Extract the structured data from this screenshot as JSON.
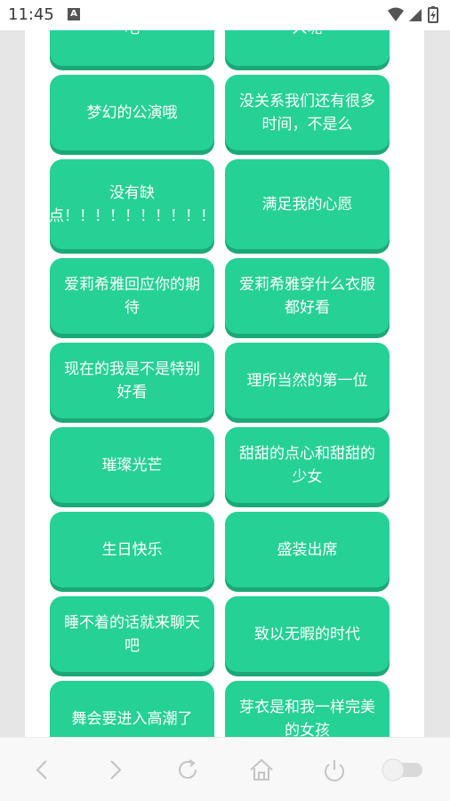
{
  "status": {
    "time": "11:45",
    "notification_badge": "A"
  },
  "cards": [
    {
      "label": "吧"
    },
    {
      "label": "人呢"
    },
    {
      "label": "梦幻的公演哦"
    },
    {
      "label": "没关系我们还有很多时间，不是么"
    },
    {
      "label": "没有缺点！！！！！！！！！！"
    },
    {
      "label": "满足我的心愿"
    },
    {
      "label": "爱莉希雅回应你的期待"
    },
    {
      "label": "爱莉希雅穿什么衣服都好看"
    },
    {
      "label": "现在的我是不是特别好看"
    },
    {
      "label": "理所当然的第一位"
    },
    {
      "label": "璀璨光芒"
    },
    {
      "label": "甜甜的点心和甜甜的少女"
    },
    {
      "label": "生日快乐"
    },
    {
      "label": "盛装出席"
    },
    {
      "label": "睡不着的话就来聊天吧"
    },
    {
      "label": "致以无暇的时代"
    },
    {
      "label": "舞会要进入高潮了"
    },
    {
      "label": "芽衣是和我一样完美的女孩"
    }
  ],
  "colors": {
    "card": "#25d195",
    "card_shadow": "#1ba877"
  },
  "bottom_nav": [
    "back-icon",
    "forward-icon",
    "refresh-icon",
    "home-icon",
    "power-icon",
    "toggle-switch"
  ]
}
